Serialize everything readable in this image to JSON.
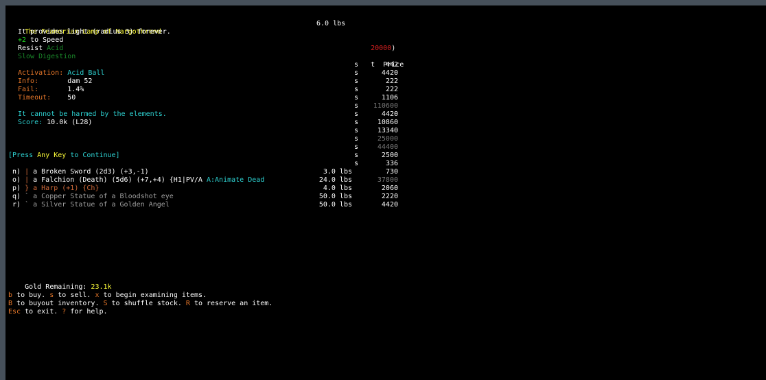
{
  "colors": {
    "white": "#ffffff",
    "yellow": "#ffff3a",
    "green": "#22dd22",
    "dkgreen": "#1a8a2a",
    "orange": "#e8782a",
    "cyan": "#2ed3d3",
    "red": "#d82020",
    "slate": "#7a7a7a",
    "gray": "#a0a0a0",
    "umber": "#d06a3a"
  },
  "store": {
    "price_header": {
      "t": "t",
      "price": "Price"
    },
    "price_rows": [
      {
        "t": "s",
        "price": "442",
        "color": "white"
      },
      {
        "t": "s",
        "price": "4420",
        "color": "white"
      },
      {
        "t": "s",
        "price": "222",
        "color": "white"
      },
      {
        "t": "s",
        "price": "222",
        "color": "white"
      },
      {
        "t": "s",
        "price": "1106",
        "color": "white"
      },
      {
        "t": "s",
        "price": "110600",
        "color": "slate"
      },
      {
        "t": "s",
        "price": "4420",
        "color": "white"
      },
      {
        "t": "s",
        "price": "10860",
        "color": "white"
      },
      {
        "t": "s",
        "price": "13340",
        "color": "white"
      },
      {
        "t": "s",
        "price": "25000",
        "color": "slate"
      },
      {
        "t": "s",
        "price": "44400",
        "color": "slate"
      },
      {
        "t": "s",
        "price": "2500",
        "color": "white"
      },
      {
        "t": "s",
        "price": "336",
        "color": "white"
      },
      {
        "t": "",
        "price": "730",
        "color": "white"
      },
      {
        "t": "",
        "price": "37800",
        "color": "slate"
      },
      {
        "t": "",
        "price": "2060",
        "color": "white"
      },
      {
        "t": "",
        "price": "2220",
        "color": "white"
      },
      {
        "t": "",
        "price": "4420",
        "color": "white"
      }
    ],
    "partial_value": {
      "text": "20000",
      "suffix": ")"
    },
    "items": [
      {
        "label": "n)",
        "sym": "|",
        "sym_color": "umber",
        "name": "a Broken Sword (2d3) (+3,-1)",
        "name_color": "white",
        "extra": "",
        "weight": "3.0 lbs"
      },
      {
        "label": "o)",
        "sym": "|",
        "sym_color": "umber",
        "name": "a Falchion (Death) (5d6) (+7,+4) {H1|PV/A ",
        "name_color": "white",
        "extra": "A:Animate Dead",
        "weight": "24.0 lbs"
      },
      {
        "label": "p)",
        "sym": "}",
        "sym_color": "umber",
        "name": "a Harp (+1) {Ch}",
        "name_color": "umber",
        "extra": "",
        "weight": "4.0 lbs"
      },
      {
        "label": "q)",
        "sym": "`",
        "sym_color": "gray",
        "name": "a Copper Statue of a Bloodshot eye",
        "name_color": "gray",
        "extra": "",
        "weight": "50.0 lbs"
      },
      {
        "label": "r)",
        "sym": "`",
        "sym_color": "gray",
        "name": "a Silver Statue of a Golden Angel",
        "name_color": "gray",
        "extra": "",
        "weight": "50.0 lbs"
      }
    ],
    "gold": {
      "label": "Gold Remaining: ",
      "value": "23.1k"
    },
    "help_lines": [
      [
        {
          "t": "b",
          "c": "orange"
        },
        {
          "t": " to buy. ",
          "c": "white"
        },
        {
          "t": "s",
          "c": "orange"
        },
        {
          "t": " to sell. ",
          "c": "white"
        },
        {
          "t": "x",
          "c": "orange"
        },
        {
          "t": " to begin examining items.",
          "c": "white"
        }
      ],
      [
        {
          "t": "B",
          "c": "orange"
        },
        {
          "t": " to buyout inventory. ",
          "c": "white"
        },
        {
          "t": "S",
          "c": "orange"
        },
        {
          "t": " to shuffle stock. ",
          "c": "white"
        },
        {
          "t": "R",
          "c": "orange"
        },
        {
          "t": " to reserve an item.",
          "c": "white"
        }
      ],
      [
        {
          "t": "Esc",
          "c": "orange"
        },
        {
          "t": " to exit. ",
          "c": "white"
        },
        {
          "t": "?",
          "c": "orange"
        },
        {
          "t": " for help.",
          "c": "white"
        }
      ]
    ]
  },
  "popup": {
    "title": "The Feanorian Lamp of Nargothrond",
    "weight": "6.0 lbs",
    "lines": [
      [
        {
          "t": "It provides light (radius 3) forever.",
          "c": "white"
        }
      ],
      [
        {
          "t": "+2",
          "c": "green"
        },
        {
          "t": " to Speed",
          "c": "white"
        }
      ],
      [
        {
          "t": "Resist ",
          "c": "white"
        },
        {
          "t": "Acid",
          "c": "dkgreen"
        }
      ],
      [
        {
          "t": "Slow Digestion",
          "c": "dkgreen"
        }
      ],
      [],
      [
        {
          "t": "Activation: ",
          "c": "orange"
        },
        {
          "t": "Acid Ball",
          "c": "cyan"
        }
      ],
      [
        {
          "t": "Info:       ",
          "c": "orange"
        },
        {
          "t": "dam 52",
          "c": "white"
        }
      ],
      [
        {
          "t": "Fail:       ",
          "c": "orange"
        },
        {
          "t": "1.4%",
          "c": "white"
        }
      ],
      [
        {
          "t": "Timeout:    ",
          "c": "orange"
        },
        {
          "t": "50",
          "c": "white"
        }
      ],
      [],
      [
        {
          "t": "It cannot be harmed by the elements.",
          "c": "cyan"
        }
      ],
      [
        {
          "t": "Score: ",
          "c": "cyan"
        },
        {
          "t": "10.0k (L28)",
          "c": "white"
        }
      ]
    ],
    "prompt": [
      {
        "t": "[Press ",
        "c": "cyan"
      },
      {
        "t": "Any Key",
        "c": "yellow"
      },
      {
        "t": " to Continue]",
        "c": "cyan"
      }
    ]
  }
}
